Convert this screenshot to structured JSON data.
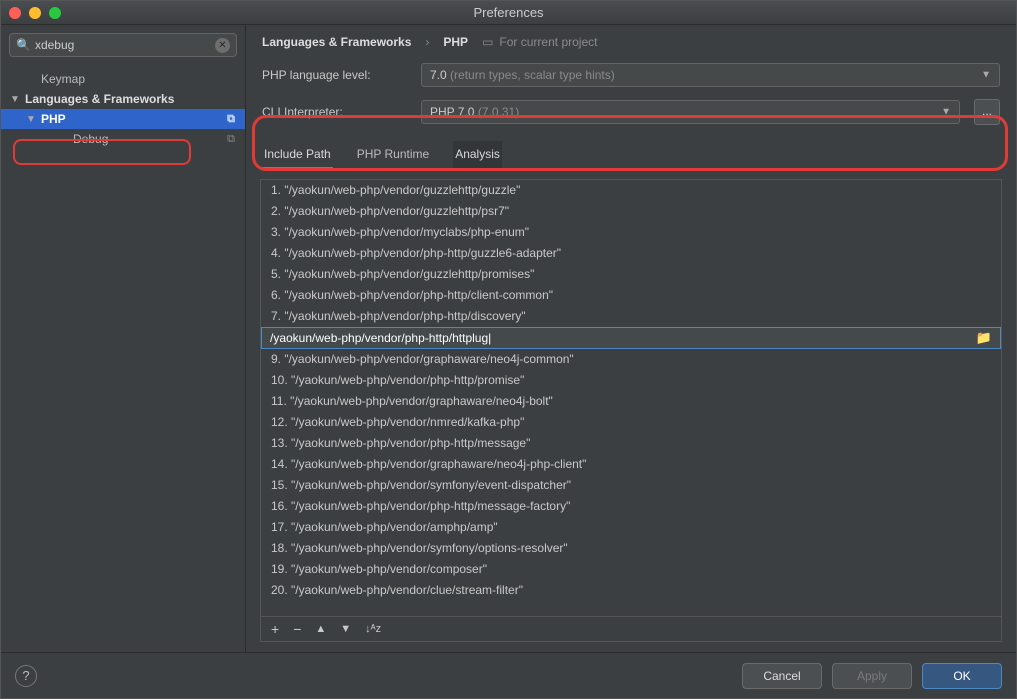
{
  "window": {
    "title": "Preferences"
  },
  "search": {
    "value": "xdebug"
  },
  "sidebar": {
    "items": [
      {
        "label": "Keymap",
        "indent": 1,
        "arrow": "",
        "bold": false
      },
      {
        "label": "Languages & Frameworks",
        "indent": 0,
        "arrow": "▼",
        "bold": true
      },
      {
        "label": "PHP",
        "indent": 1,
        "arrow": "▼",
        "bold": true,
        "selected": true,
        "copy": true
      },
      {
        "label": "Debug",
        "indent": 2,
        "arrow": "",
        "bold": false,
        "copy": true
      }
    ]
  },
  "breadcrumb": {
    "part1": "Languages & Frameworks",
    "sep": "›",
    "part2": "PHP",
    "scope": "For current project"
  },
  "lang_level": {
    "label": "PHP language level:",
    "value": "7.0",
    "hint": "(return types, scalar type hints)"
  },
  "cli": {
    "label": "CLI Interpreter:",
    "value": "PHP 7.0",
    "hint": "(7.0.31)",
    "button": "..."
  },
  "tabs": [
    {
      "label": "Include Path",
      "state": "active"
    },
    {
      "label": "PHP Runtime",
      "state": ""
    },
    {
      "label": "Analysis",
      "state": "hover"
    }
  ],
  "paths": [
    "1.  \"/yaokun/web-php/vendor/guzzlehttp/guzzle\"",
    "2.  \"/yaokun/web-php/vendor/guzzlehttp/psr7\"",
    "3.  \"/yaokun/web-php/vendor/myclabs/php-enum\"",
    "4.  \"/yaokun/web-php/vendor/php-http/guzzle6-adapter\"",
    "5.  \"/yaokun/web-php/vendor/guzzlehttp/promises\"",
    "6.  \"/yaokun/web-php/vendor/php-http/client-common\"",
    "7.  \"/yaokun/web-php/vendor/php-http/discovery\"",
    "/yaokun/web-php/vendor/php-http/httplug|",
    "9.  \"/yaokun/web-php/vendor/graphaware/neo4j-common\"",
    "10.  \"/yaokun/web-php/vendor/php-http/promise\"",
    "11.  \"/yaokun/web-php/vendor/graphaware/neo4j-bolt\"",
    "12.  \"/yaokun/web-php/vendor/nmred/kafka-php\"",
    "13.  \"/yaokun/web-php/vendor/php-http/message\"",
    "14.  \"/yaokun/web-php/vendor/graphaware/neo4j-php-client\"",
    "15.  \"/yaokun/web-php/vendor/symfony/event-dispatcher\"",
    "16.  \"/yaokun/web-php/vendor/php-http/message-factory\"",
    "17.  \"/yaokun/web-php/vendor/amphp/amp\"",
    "18.  \"/yaokun/web-php/vendor/symfony/options-resolver\"",
    "19.  \"/yaokun/web-php/vendor/composer\"",
    "20.  \"/yaokun/web-php/vendor/clue/stream-filter\""
  ],
  "editing_index": 7,
  "toolbar": {
    "add": "+",
    "remove": "−",
    "up": "▲",
    "down": "▼",
    "sort": "↓ᴬz"
  },
  "footer": {
    "help": "?",
    "cancel": "Cancel",
    "apply": "Apply",
    "ok": "OK"
  }
}
